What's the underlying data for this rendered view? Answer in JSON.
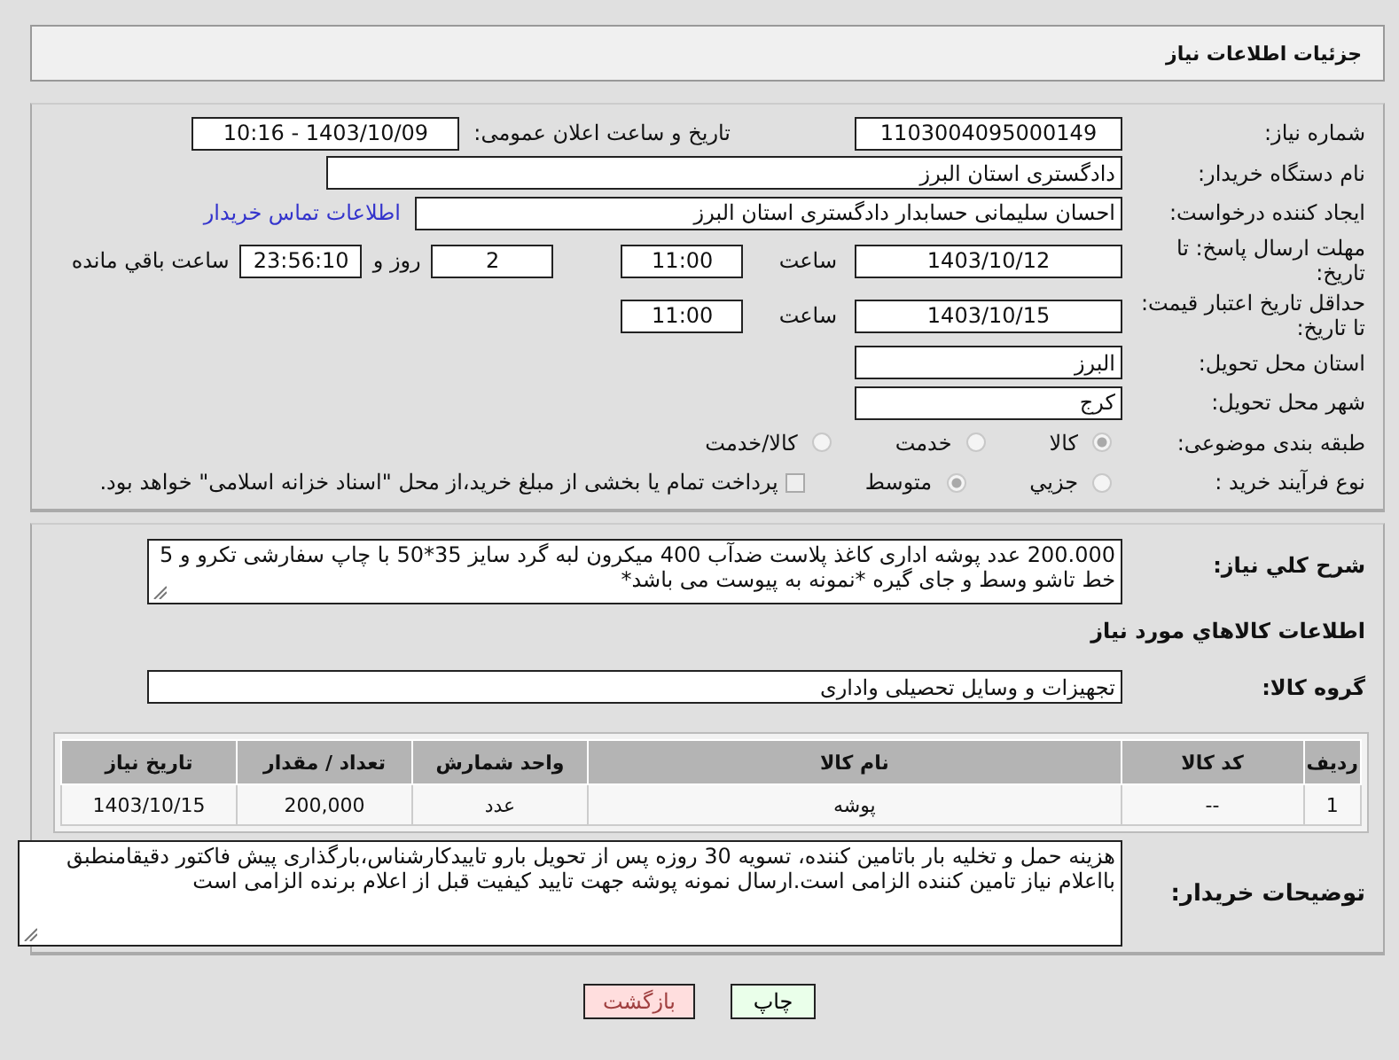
{
  "header": {
    "title": "جزئیات اطلاعات نیاز"
  },
  "need_number": {
    "label": "شماره نیاز:",
    "value": "1103004095000149"
  },
  "announce": {
    "label": "تاریخ و ساعت اعلان عمومی:",
    "value": "1403/10/09 - 10:16"
  },
  "buyer_org": {
    "label": "نام دستگاه خریدار:",
    "value": "دادگستری استان البرز"
  },
  "requester": {
    "label": "ایجاد کننده درخواست:",
    "value": "احسان سلیمانی حسابدار دادگستری استان البرز",
    "link": "اطلاعات تماس خریدار"
  },
  "reply_deadline": {
    "label": "مهلت ارسال پاسخ: تا تاریخ:",
    "date": "1403/10/12",
    "time_label": "ساعت",
    "time": "11:00",
    "days": "2",
    "days_label": "روز و",
    "remaining": "23:56:10",
    "remaining_label": "ساعت باقي مانده"
  },
  "price_validity": {
    "label": "حداقل تاریخ اعتبار قیمت: تا تاریخ:",
    "date": "1403/10/15",
    "time_label": "ساعت",
    "time": "11:00"
  },
  "province": {
    "label": "استان محل تحویل:",
    "value": "البرز"
  },
  "city": {
    "label": "شهر محل تحویل:",
    "value": "کرج"
  },
  "category": {
    "label": "طبقه بندی موضوعی:",
    "options": [
      {
        "label": "کالا",
        "selected": true
      },
      {
        "label": "خدمت",
        "selected": false
      },
      {
        "label": "کالا/خدمت",
        "selected": false
      }
    ]
  },
  "process": {
    "label": "نوع فرآیند خرید :",
    "options": [
      {
        "label": "جزیي",
        "selected": false
      },
      {
        "label": "متوسط",
        "selected": true
      }
    ],
    "payment": {
      "label": "پرداخت تمام یا بخشی از مبلغ خرید،از محل \"اسناد خزانه اسلامی\" خواهد بود.",
      "checked": false
    }
  },
  "description": {
    "label": "شرح کلي نياز:",
    "value": "200.000 عدد پوشه اداری کاغذ پلاست ضدآب 400 میکرون لبه گرد سایز 35*50 با چاپ سفارشی تکرو و 5 خط تاشو وسط و جای گیره *نمونه به پیوست می باشد*"
  },
  "goods_title": "اطلاعات کالاهاي مورد نياز",
  "group": {
    "label": "گروه کالا:",
    "value": "تجهیزات و وسایل تحصیلی واداری"
  },
  "table": {
    "columns": [
      "رديف",
      "کد کالا",
      "نام کالا",
      "واحد شمارش",
      "تعداد / مقدار",
      "تاریخ نیاز"
    ],
    "rows": [
      [
        "1",
        "--",
        "پوشه",
        "عدد",
        "200,000",
        "1403/10/15"
      ]
    ]
  },
  "buyer_notes": {
    "label": "توضیحات خریدار:",
    "value": "هزینه حمل و تخلیه بار باتامین کننده، تسویه 30 روزه پس از تحویل بارو تاییدکارشناس،بارگذاری پیش فاکتور دقیقامنطبق بااعلام نیاز تامین کننده الزامی است.ارسال نمونه پوشه جهت تایید کیفیت قبل از اعلام برنده الزامی است"
  },
  "buttons": [
    {
      "label": "چاپ",
      "kind": "print"
    },
    {
      "label": "بازگشت",
      "kind": "back"
    }
  ]
}
